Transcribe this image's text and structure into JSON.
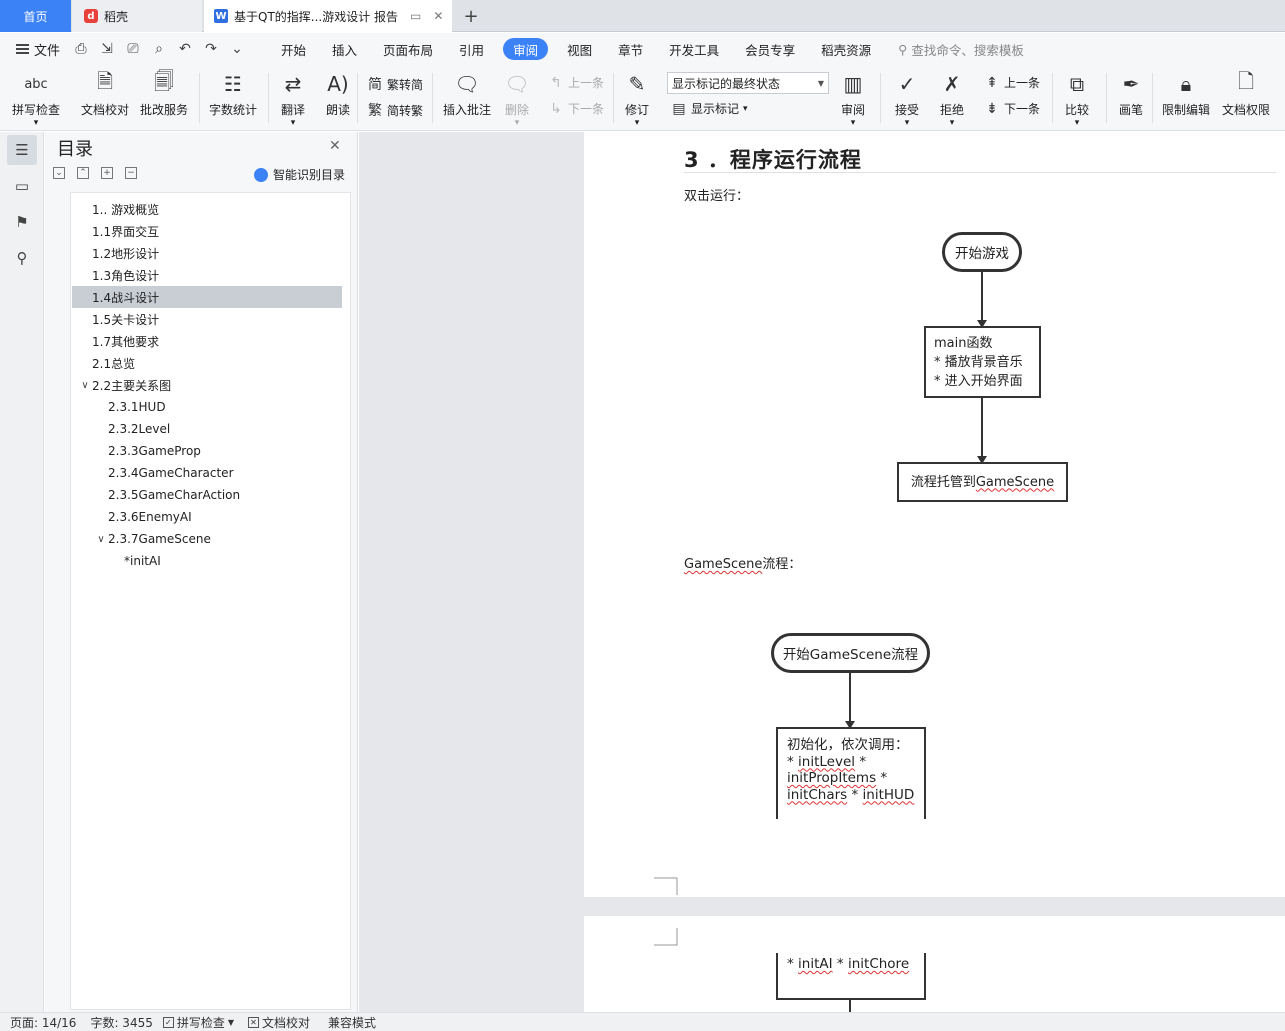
{
  "tabs": {
    "home": "首页",
    "docer": "稻壳",
    "document": "基于QT的指挥...游戏设计 报告",
    "new_tab": "+"
  },
  "menu": {
    "file": "文件",
    "items": [
      "开始",
      "插入",
      "页面布局",
      "引用",
      "审阅",
      "视图",
      "章节",
      "开发工具",
      "会员专享",
      "稻壳资源"
    ],
    "active": "审阅",
    "search_placeholder": "查找命令、搜索模板"
  },
  "ribbon": {
    "spell_check": "拼写检查",
    "doc_proof": "文档校对",
    "review_service": "批改服务",
    "word_count": "字数统计",
    "translate": "翻译",
    "read_aloud": "朗读",
    "trad_to_simp": "繁转简",
    "simp_to_trad": "简转繁",
    "insert_comment": "插入批注",
    "delete": "删除",
    "prev_comment": "上一条",
    "next_comment": "下一条",
    "track_changes": "修订",
    "markup_state": "显示标记的最终状态",
    "show_markup": "显示标记",
    "review": "审阅",
    "accept": "接受",
    "reject": "拒绝",
    "prev_change": "上一条",
    "next_change": "下一条",
    "compare": "比较",
    "ink": "画笔",
    "restrict_edit": "限制编辑",
    "doc_permission": "文档权限"
  },
  "toc": {
    "title": "目录",
    "smart_toc": "智能识别目录",
    "items": [
      {
        "label": "1.. 游戏概览",
        "level": 1
      },
      {
        "label": "1.1界面交互",
        "level": 1
      },
      {
        "label": "1.2地形设计",
        "level": 1
      },
      {
        "label": "1.3角色设计",
        "level": 1
      },
      {
        "label": "1.4战斗设计",
        "level": 1
      },
      {
        "label": "1.5关卡设计",
        "level": 1
      },
      {
        "label": "1.7其他要求",
        "level": 1
      },
      {
        "label": "2.1总览",
        "level": 1
      },
      {
        "label": "2.2主要关系图",
        "level": 1
      },
      {
        "label": "2.3.1HUD",
        "level": 2
      },
      {
        "label": "2.3.2Level",
        "level": 2
      },
      {
        "label": "2.3.3GameProp",
        "level": 2
      },
      {
        "label": "2.3.4GameCharacter",
        "level": 2
      },
      {
        "label": "2.3.5GameCharAction",
        "level": 2
      },
      {
        "label": "2.3.6EnemyAI",
        "level": 2
      },
      {
        "label": "2.3.7GameScene",
        "level": 2
      },
      {
        "label": "*initAI",
        "level": 3
      }
    ],
    "selected_index": 4
  },
  "doc": {
    "heading": "3 ．程序运行流程",
    "double_click_run": "双击运行：",
    "flow1": {
      "start": "开始游戏",
      "main_lines": [
        "main函数",
        "* 播放背景音乐",
        "* 进入开始界面"
      ],
      "handoff_prefix": "流程托管到",
      "handoff_term": "GameScene"
    },
    "gamescene_label_term": "GameScene",
    "gamescene_label_suffix": "流程：",
    "flow2": {
      "start": "开始GameScene流程",
      "init_title": "初始化，依次调用：",
      "init_calls": [
        "initLevel",
        "initPropItems",
        "initChars",
        "initHUD"
      ],
      "init_calls_cont": [
        "initAI",
        "initChore"
      ]
    }
  },
  "status": {
    "page": "页面: 14/16",
    "words": "字数: 3455",
    "spell": "拼写检查",
    "proof": "文档校对",
    "compat": "兼容模式"
  }
}
